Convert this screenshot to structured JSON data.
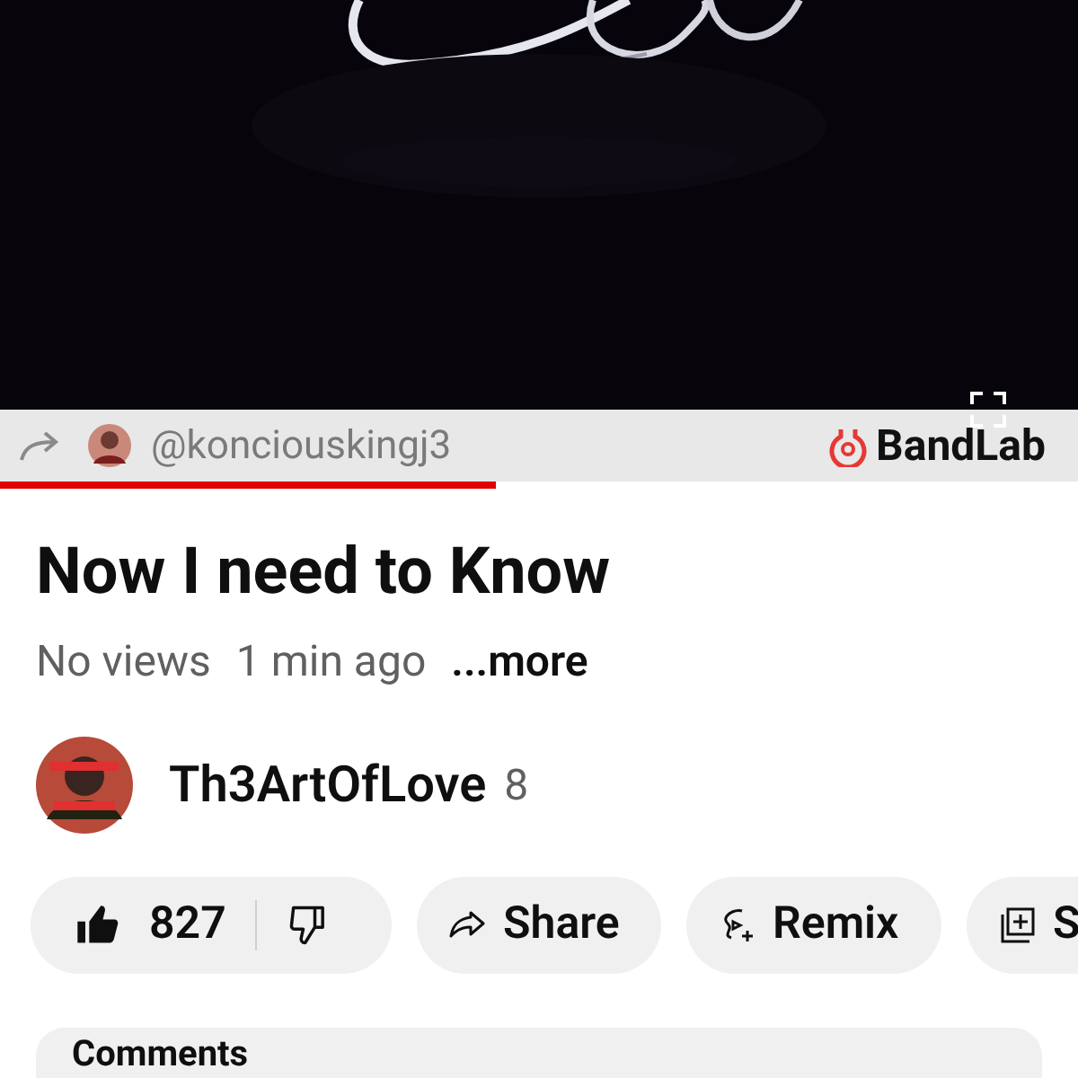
{
  "player": {
    "kind": "picture",
    "credit": "@konciouskingj3",
    "brand": "BandLab",
    "progress": {
      "level": 0.46
    }
  },
  "title": "Now I need to Know",
  "meta": {
    "views": "No views",
    "time": "1 min ago",
    "more": "...more"
  },
  "channel": {
    "name": "Th3ArtOfLove",
    "count": "8"
  },
  "actions": [
    {
      "kind": "like",
      "label": "827"
    },
    {
      "kind": "share",
      "label": "Share"
    },
    {
      "kind": "remix",
      "label": "Remix"
    },
    {
      "kind": "save",
      "label": "S"
    }
  ],
  "comments": {
    "title": "Comments"
  }
}
